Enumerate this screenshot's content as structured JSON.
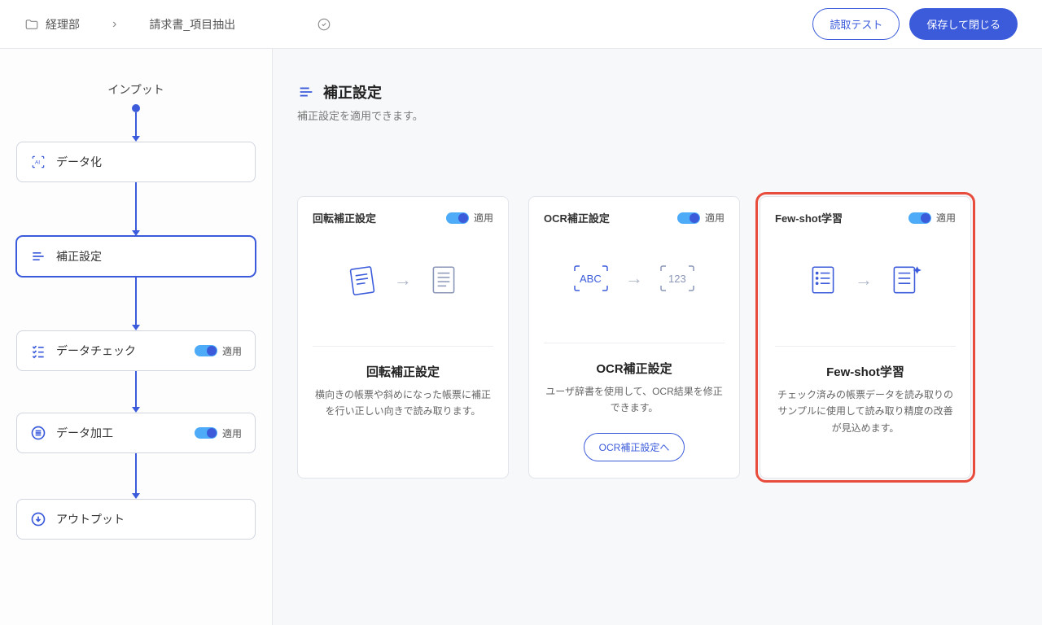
{
  "breadcrumb": {
    "folder": "経理部",
    "doc": "請求書_項目抽出"
  },
  "header": {
    "test": "読取テスト",
    "save": "保存して閉じる"
  },
  "flow": {
    "title": "インプット",
    "n1": "データ化",
    "n2": "補正設定",
    "n3": "データチェック",
    "n3apply": "適用",
    "n4": "データ加工",
    "n4apply": "適用",
    "n5": "アウトプット"
  },
  "section": {
    "title": "補正設定",
    "sub": "補正設定を適用できます。"
  },
  "cards": [
    {
      "head": "回転補正設定",
      "apply": "適用",
      "title": "回転補正設定",
      "desc": "横向きの帳票や斜めになった帳票に補正を行い正しい向きで読み取ります。"
    },
    {
      "head": "OCR補正設定",
      "apply": "適用",
      "title": "OCR補正設定",
      "desc": "ユーザ辞書を使用して、OCR結果を修正できます。",
      "link": "OCR補正設定へ"
    },
    {
      "head": "Few-shot学習",
      "apply": "適用",
      "title": "Few-shot学習",
      "desc": "チェック済みの帳票データを読み取りのサンプルに使用して読み取り精度の改善が見込めます。"
    }
  ]
}
